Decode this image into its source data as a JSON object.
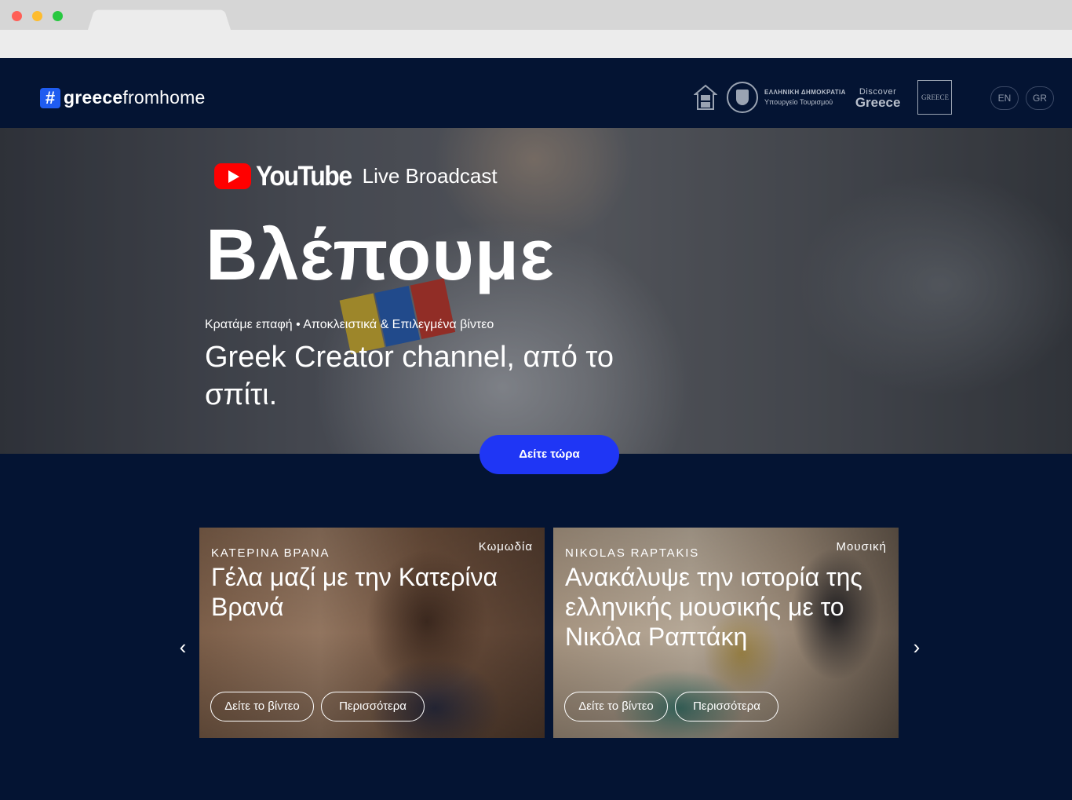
{
  "header": {
    "logo_hash": "#",
    "logo_bold": "greece",
    "logo_light": "fromhome",
    "partners": {
      "ministry_line1": "ΕΛΛΗΝΙΚΗ ΔΗΜΟΚΡΑΤΙΑ",
      "ministry_line2": "Υπουργείο Τουρισμού",
      "discover_line1": "Discover",
      "discover_line2": "Greece",
      "greece_box": "GREECE"
    },
    "languages": [
      "EN",
      "GR"
    ]
  },
  "hero": {
    "brand": "YouTube",
    "brand_suffix": "Live Broadcast",
    "title": "Βλέπουμε",
    "subtitle": "Κρατάμε επαφή • Αποκλειστικά & Επιλεγμένα βίντεο",
    "headline": "Greek Creator channel, από το σπίτι.",
    "cta_label": "Δείτε τώρα"
  },
  "carousel": {
    "prev": "‹",
    "next": "›",
    "cards": [
      {
        "eyebrow": "ΚΑΤΕΡΙΝΑ ΒΡΑΝΑ",
        "category": "Κωμωδία",
        "title": "Γέλα μαζί με την Κατερίνα Βρανά",
        "watch_label": "Δείτε το βίντεο",
        "more_label": "Περισσότερα"
      },
      {
        "eyebrow": "NIKOLAS RAPTAKIS",
        "category": "Μουσική",
        "title": "Ανακάλυψε την ιστορία της ελληνικής μουσικής με το Νικόλα Ραπτάκη",
        "watch_label": "Δείτε το βίντεο",
        "more_label": "Περισσότερα"
      }
    ]
  },
  "colors": {
    "page_bg": "#041433",
    "cta": "#1f36f5",
    "logo_accent": "#1f5cf0",
    "youtube_red": "#ff0000"
  }
}
